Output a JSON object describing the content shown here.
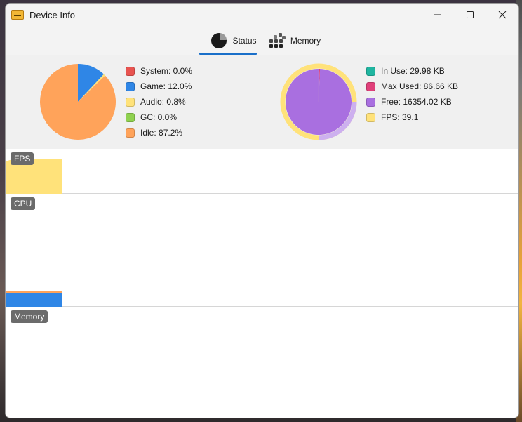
{
  "window": {
    "title": "Device Info"
  },
  "tabs": [
    {
      "label": "Status",
      "icon": "pie-chart-icon",
      "selected": true
    },
    {
      "label": "Memory",
      "icon": "memory-grid-icon",
      "selected": false
    }
  ],
  "status_legend": [
    {
      "label": "System: 0.0%",
      "color": "#e8534f"
    },
    {
      "label": "Game: 12.0%",
      "color": "#2f86e6"
    },
    {
      "label": "Audio: 0.8%",
      "color": "#ffe27a"
    },
    {
      "label": "GC: 0.0%",
      "color": "#8fd14f"
    },
    {
      "label": "Idle: 87.2%",
      "color": "#ffa35a"
    }
  ],
  "memory_legend": [
    {
      "label": "In Use: 29.98 KB",
      "color": "#1fb5a0"
    },
    {
      "label": "Max Used: 86.66 KB",
      "color": "#e0407a"
    },
    {
      "label": "Free: 16354.02 KB",
      "color": "#a96fe0"
    },
    {
      "label": "FPS: 39.1",
      "color": "#ffe27a"
    }
  ],
  "graphs": {
    "fps_label": "FPS",
    "cpu_label": "CPU",
    "memory_label": "Memory"
  },
  "chart_data": [
    {
      "type": "pie",
      "categories": [
        "System",
        "Game",
        "Audio",
        "GC",
        "Idle"
      ],
      "values": [
        0.0,
        12.0,
        0.8,
        0.0,
        87.2
      ],
      "colors": [
        "#e8534f",
        "#2f86e6",
        "#ffe27a",
        "#8fd14f",
        "#ffa35a"
      ]
    },
    {
      "type": "pie",
      "categories": [
        "In Use",
        "Max Used",
        "Free"
      ],
      "values": [
        29.98,
        86.66,
        16354.02
      ],
      "colors": [
        "#1fb5a0",
        "#e0407a",
        "#a96fe0"
      ],
      "ring": {
        "label": "FPS",
        "value": 39.1,
        "color": "#ffe27a"
      }
    }
  ]
}
